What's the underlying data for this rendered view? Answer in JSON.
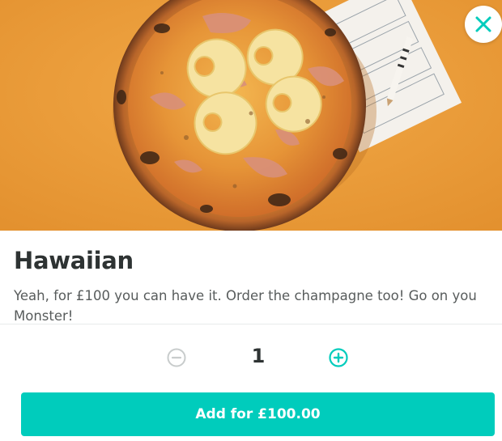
{
  "item": {
    "title": "Hawaiian",
    "description": "Yeah, for £100 you can have it. Order the champagne too! Go on you Monster!",
    "image_icon": "pizza-photo"
  },
  "quantity": {
    "value": "1",
    "decrease_icon": "minus-circle-icon",
    "increase_icon": "plus-circle-icon"
  },
  "actions": {
    "close_icon": "close-icon",
    "add_label": "Add for £100.00"
  },
  "colors": {
    "accent": "#00ccbc",
    "hero_background": "#eb9c3a",
    "text_primary": "#2e3333",
    "text_secondary": "#585c5c",
    "disabled": "#c8cccc"
  }
}
